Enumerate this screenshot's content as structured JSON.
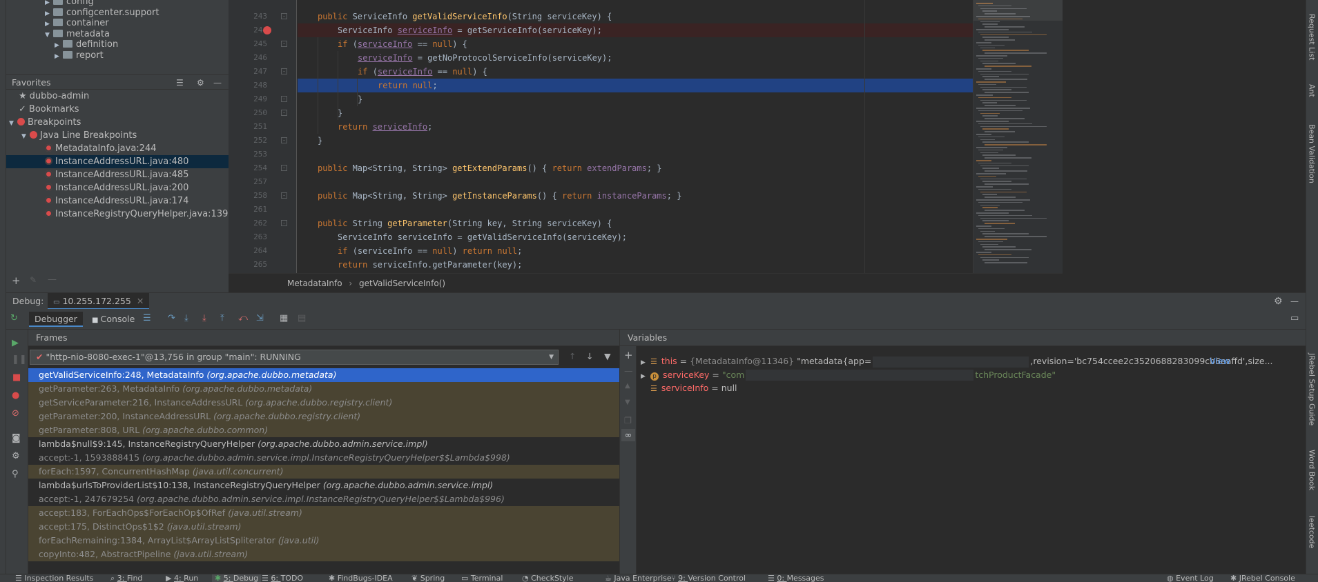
{
  "project_tree": [
    {
      "label": "config",
      "indent": 0,
      "expanded": false
    },
    {
      "label": "configcenter.support",
      "indent": 0,
      "expanded": false
    },
    {
      "label": "container",
      "indent": 0,
      "expanded": false
    },
    {
      "label": "metadata",
      "indent": 0,
      "expanded": true
    },
    {
      "label": "definition",
      "indent": 1,
      "expanded": false
    },
    {
      "label": "report",
      "indent": 1,
      "expanded": false
    }
  ],
  "favorites": {
    "title": "Favorites",
    "root": "dubbo-admin",
    "bookmarks": "Bookmarks",
    "breakpoints": "Breakpoints",
    "java_line": "Java Line Breakpoints",
    "items": [
      "MetadataInfo.java:244",
      "InstanceAddressURL.java:480",
      "InstanceAddressURL.java:485",
      "InstanceAddressURL.java:200",
      "InstanceAddressURL.java:174",
      "InstanceRegistryQueryHelper.java:139"
    ]
  },
  "editor": {
    "lines": [
      {
        "n": "243",
        "tokens": [
          [
            "kw",
            "public "
          ],
          [
            "",
            "ServiceInfo "
          ],
          [
            "fn",
            "getValidServiceInfo"
          ],
          [
            "",
            "(String serviceKey) {"
          ]
        ],
        "indent": 4
      },
      {
        "n": "244",
        "tokens": [
          [
            "",
            "ServiceInfo "
          ],
          [
            "ul",
            "serviceInfo"
          ],
          [
            "",
            " = getServiceInfo(serviceKey);"
          ]
        ],
        "indent": 8
      },
      {
        "n": "245",
        "tokens": [
          [
            "kw",
            "if "
          ],
          [
            "",
            "("
          ],
          [
            "ul",
            "serviceInfo"
          ],
          [
            "",
            " == "
          ],
          [
            "kw",
            "null"
          ],
          [
            "",
            ") {"
          ]
        ],
        "indent": 8
      },
      {
        "n": "246",
        "tokens": [
          [
            "ul",
            "serviceInfo"
          ],
          [
            "",
            " = getNoProtocolServiceInfo(serviceKey);"
          ]
        ],
        "indent": 12
      },
      {
        "n": "247",
        "tokens": [
          [
            "kw",
            "if "
          ],
          [
            "",
            "("
          ],
          [
            "ul",
            "serviceInfo"
          ],
          [
            "",
            " == "
          ],
          [
            "kw",
            "null"
          ],
          [
            "",
            ") {"
          ]
        ],
        "indent": 12
      },
      {
        "n": "248",
        "tokens": [
          [
            "kw",
            "return null"
          ],
          [
            "",
            ";"
          ]
        ],
        "indent": 16
      },
      {
        "n": "249",
        "tokens": [
          [
            "",
            "}"
          ]
        ],
        "indent": 12
      },
      {
        "n": "250",
        "tokens": [
          [
            "",
            "}"
          ]
        ],
        "indent": 8
      },
      {
        "n": "251",
        "tokens": [
          [
            "kw",
            "return "
          ],
          [
            "ul",
            "serviceInfo"
          ],
          [
            "",
            ";"
          ]
        ],
        "indent": 8
      },
      {
        "n": "252",
        "tokens": [
          [
            "",
            "}"
          ]
        ],
        "indent": 4
      },
      {
        "n": "253",
        "tokens": [],
        "indent": 0
      },
      {
        "n": "254",
        "tokens": [
          [
            "kw",
            "public "
          ],
          [
            "",
            "Map<String, String> "
          ],
          [
            "fn",
            "getExtendParams"
          ],
          [
            "",
            "() { "
          ],
          [
            "kw",
            "return "
          ],
          [
            "fld",
            "extendParams"
          ],
          [
            "",
            "; }"
          ]
        ],
        "indent": 4
      },
      {
        "n": "257",
        "tokens": [],
        "indent": 0
      },
      {
        "n": "258",
        "tokens": [
          [
            "kw",
            "public "
          ],
          [
            "",
            "Map<String, String> "
          ],
          [
            "fn",
            "getInstanceParams"
          ],
          [
            "",
            "() { "
          ],
          [
            "kw",
            "return "
          ],
          [
            "fld",
            "instanceParams"
          ],
          [
            "",
            "; }"
          ]
        ],
        "indent": 4
      },
      {
        "n": "261",
        "tokens": [],
        "indent": 0
      },
      {
        "n": "262",
        "tokens": [
          [
            "kw",
            "public "
          ],
          [
            "",
            "String "
          ],
          [
            "fn",
            "getParameter"
          ],
          [
            "",
            "(String key, String serviceKey) {"
          ]
        ],
        "indent": 4
      },
      {
        "n": "263",
        "tokens": [
          [
            "",
            "ServiceInfo serviceInfo = getValidServiceInfo(serviceKey);"
          ]
        ],
        "indent": 8
      },
      {
        "n": "264",
        "tokens": [
          [
            "kw",
            "if "
          ],
          [
            "",
            "(serviceInfo == "
          ],
          [
            "kw",
            "null"
          ],
          [
            "",
            ") "
          ],
          [
            "kw",
            "return null"
          ],
          [
            "",
            ";"
          ]
        ],
        "indent": 8
      },
      {
        "n": "265",
        "tokens": [
          [
            "kw",
            "return "
          ],
          [
            "",
            "serviceInfo.getParameter(key);"
          ]
        ],
        "indent": 8
      }
    ],
    "breadcrumb": [
      "MetadataInfo",
      "getValidServiceInfo()"
    ]
  },
  "debug": {
    "label": "Debug:",
    "session": "10.255.172.255",
    "tab_debugger": "Debugger",
    "tab_console": "Console",
    "frames_title": "Frames",
    "thread": "\"http-nio-8080-exec-1\"@13,756 in group \"main\": RUNNING",
    "frames": [
      {
        "m": "getValidServiceInfo:248, MetadataInfo",
        "p": "(org.apache.dubbo.metadata)",
        "k": "sel"
      },
      {
        "m": "getParameter:263, MetadataInfo",
        "p": "(org.apache.dubbo.metadata)",
        "k": "lib"
      },
      {
        "m": "getServiceParameter:216, InstanceAddressURL",
        "p": "(org.apache.dubbo.registry.client)",
        "k": "lib"
      },
      {
        "m": "getParameter:200, InstanceAddressURL",
        "p": "(org.apache.dubbo.registry.client)",
        "k": "lib"
      },
      {
        "m": "getParameter:808, URL",
        "p": "(org.apache.dubbo.common)",
        "k": "lib"
      },
      {
        "m": "lambda$null$9:145, InstanceRegistryQueryHelper",
        "p": "(org.apache.dubbo.admin.service.impl)",
        "k": "usr"
      },
      {
        "m": "accept:-1, 1593888415",
        "p": "(org.apache.dubbo.admin.service.impl.InstanceRegistryQueryHelper$$Lambda$998)",
        "k": "dim"
      },
      {
        "m": "forEach:1597, ConcurrentHashMap",
        "p": "(java.util.concurrent)",
        "k": "lib"
      },
      {
        "m": "lambda$urlsToProviderList$10:138, InstanceRegistryQueryHelper",
        "p": "(org.apache.dubbo.admin.service.impl)",
        "k": "usr"
      },
      {
        "m": "accept:-1, 247679254",
        "p": "(org.apache.dubbo.admin.service.impl.InstanceRegistryQueryHelper$$Lambda$996)",
        "k": "dim"
      },
      {
        "m": "accept:183, ForEachOps$ForEachOp$OfRef",
        "p": "(java.util.stream)",
        "k": "lib"
      },
      {
        "m": "accept:175, DistinctOps$1$2",
        "p": "(java.util.stream)",
        "k": "lib"
      },
      {
        "m": "forEachRemaining:1384, ArrayList$ArrayListSpliterator",
        "p": "(java.util)",
        "k": "lib"
      },
      {
        "m": "copyInto:482, AbstractPipeline",
        "p": "(java.util.stream)",
        "k": "lib"
      }
    ],
    "vars_title": "Variables",
    "vars": [
      {
        "name": "this",
        "eq": " = ",
        "val1": "{MetadataInfo@11346} ",
        "val2": "\"metadata{app=",
        "val3": ",revision='bc754ccee2c3520688283099cb6eaffd',size...",
        "link": "View"
      },
      {
        "name": "serviceKey",
        "eq": " = ",
        "val1": "\"com",
        "val3": "tchProductFacade\""
      },
      {
        "name": "serviceInfo",
        "eq": " = ",
        "val1": "null"
      }
    ]
  },
  "right_tabs": [
    "Request List",
    "Ant",
    "Bean Validation",
    "JRebel Setup Guide",
    "Word Book",
    "leetcode"
  ],
  "status_bar": [
    {
      "label": "Inspection Results",
      "key": ""
    },
    {
      "label": "Find",
      "key": "3: "
    },
    {
      "label": "Run",
      "key": "4: "
    },
    {
      "label": "Debug",
      "key": "5: "
    },
    {
      "label": "TODO",
      "key": "6: "
    },
    {
      "label": "FindBugs-IDEA",
      "key": ""
    },
    {
      "label": "Spring",
      "key": ""
    },
    {
      "label": "Terminal",
      "key": ""
    },
    {
      "label": "CheckStyle",
      "key": ""
    },
    {
      "label": "Java Enterprise",
      "key": ""
    },
    {
      "label": "Version Control",
      "key": "9: "
    },
    {
      "label": "Messages",
      "key": "0: "
    },
    {
      "label": "Event Log",
      "key": ""
    },
    {
      "label": "JRebel Console",
      "key": ""
    }
  ],
  "colors": {
    "selection": "#2f65ca",
    "current_line": "#214283",
    "breakpoint": "#d94b4b"
  }
}
